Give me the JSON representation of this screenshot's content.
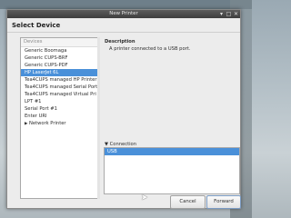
{
  "window": {
    "title": "New Printer",
    "min_glyph": "▾",
    "max_glyph": "□",
    "close_glyph": "✕"
  },
  "heading": "Select Device",
  "devices": {
    "header": "Devices",
    "items": [
      {
        "label": "Generic Boomaga",
        "selected": false
      },
      {
        "label": "Generic CUPS-BRF",
        "selected": false
      },
      {
        "label": "Generic CUPS-PDF",
        "selected": false
      },
      {
        "label": "HP LaserJet 6L",
        "selected": true
      },
      {
        "label": "Tea4CUPS managed HP Printer",
        "selected": false
      },
      {
        "label": "Tea4CUPS managed Serial Port",
        "selected": false
      },
      {
        "label": "Tea4CUPS managed Virtual Pri",
        "selected": false
      },
      {
        "label": "LPT #1",
        "selected": false
      },
      {
        "label": "Serial Port #1",
        "selected": false
      },
      {
        "label": "Enter URI",
        "selected": false
      },
      {
        "label": "Network Printer",
        "selected": false,
        "expander": "▶"
      }
    ]
  },
  "description": {
    "title": "Description",
    "text": "A printer connected to a USB port."
  },
  "connection": {
    "expander_glyph": "▼",
    "label": "Connection",
    "items": [
      "USB"
    ]
  },
  "buttons": {
    "cancel": "Cancel",
    "forward": "Forward"
  },
  "colors": {
    "selection": "#4a90d9",
    "titlebar": "#4a4a4a",
    "dialog_bg": "#ececec"
  }
}
